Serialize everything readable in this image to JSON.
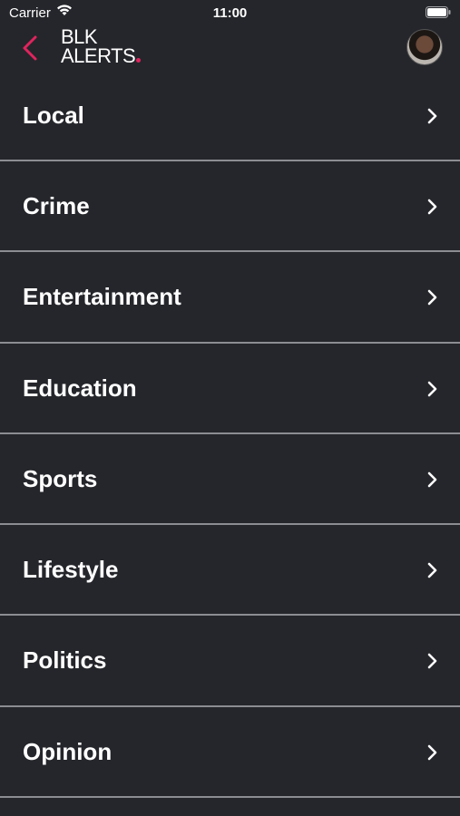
{
  "status_bar": {
    "carrier": "Carrier",
    "time": "11:00"
  },
  "header": {
    "logo_line1": "BLK",
    "logo_line2": "ALERTS",
    "accent_color": "#e0245e"
  },
  "menu": {
    "items": [
      {
        "label": "Local"
      },
      {
        "label": "Crime"
      },
      {
        "label": "Entertainment"
      },
      {
        "label": "Education"
      },
      {
        "label": "Sports"
      },
      {
        "label": "Lifestyle"
      },
      {
        "label": "Politics"
      },
      {
        "label": "Opinion"
      }
    ]
  },
  "colors": {
    "background": "#25262b",
    "divider": "#8c8d92",
    "text": "#ffffff"
  },
  "icons": [
    "wifi-icon",
    "battery-icon",
    "back-chevron-icon",
    "chevron-right-icon"
  ]
}
